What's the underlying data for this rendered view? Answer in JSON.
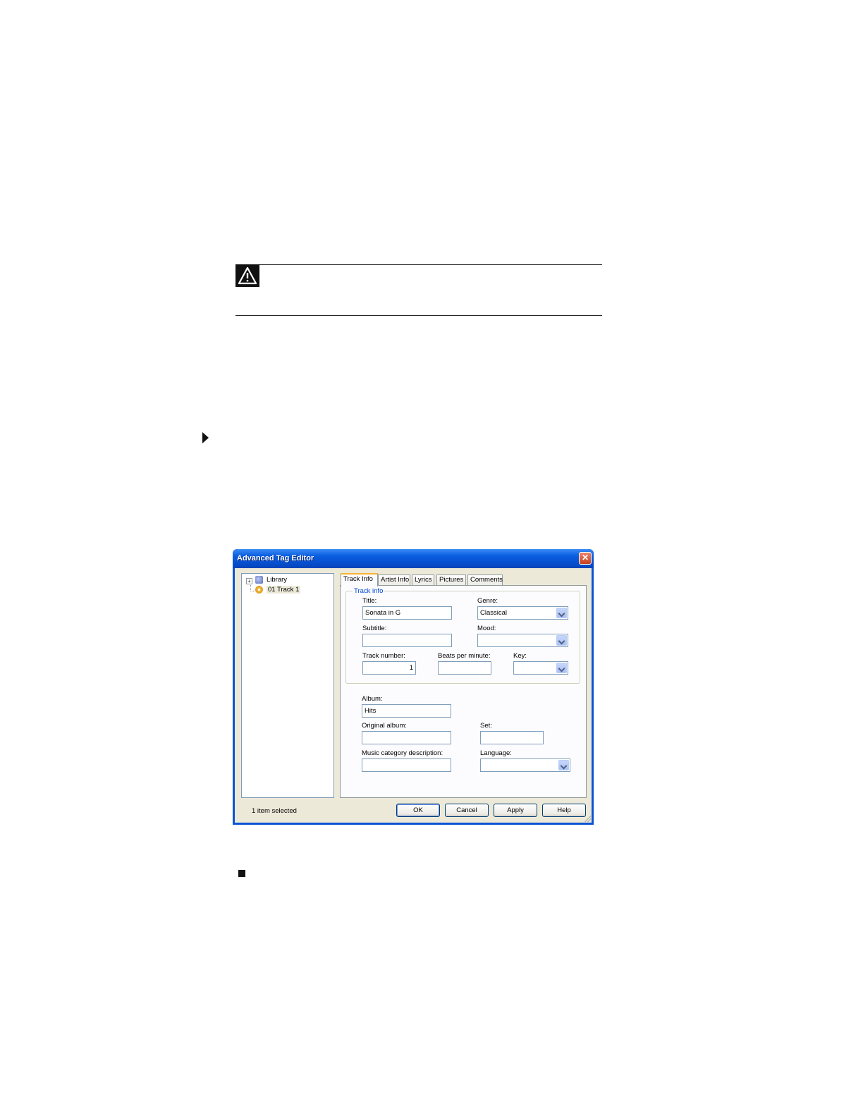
{
  "dialog": {
    "title": "Advanced Tag Editor",
    "close_glyph": "✕",
    "tree": {
      "items": [
        {
          "label": "Library",
          "expander": "+"
        },
        {
          "label": "01 Track 1"
        }
      ]
    },
    "tabs": [
      {
        "label": "Track Info",
        "active": true
      },
      {
        "label": "Artist Info"
      },
      {
        "label": "Lyrics"
      },
      {
        "label": "Pictures"
      },
      {
        "label": "Comments"
      }
    ],
    "track_info": {
      "group_label": "Track info",
      "title_label": "Title:",
      "title_value": "Sonata in G",
      "genre_label": "Genre:",
      "genre_value": "Classical",
      "subtitle_label": "Subtitle:",
      "subtitle_value": "",
      "mood_label": "Mood:",
      "mood_value": "",
      "track_number_label": "Track number:",
      "track_number_value": "1",
      "bpm_label": "Beats per minute:",
      "bpm_value": "",
      "key_label": "Key:",
      "key_value": "",
      "album_label": "Album:",
      "album_value": "Hits",
      "original_album_label": "Original album:",
      "original_album_value": "",
      "set_label": "Set:",
      "set_value": "",
      "music_category_label": "Music category description:",
      "music_category_value": "",
      "language_label": "Language:",
      "language_value": ""
    },
    "status_text": "1 item selected",
    "buttons": {
      "ok": "OK",
      "cancel": "Cancel",
      "apply": "Apply",
      "help": "Help"
    }
  }
}
